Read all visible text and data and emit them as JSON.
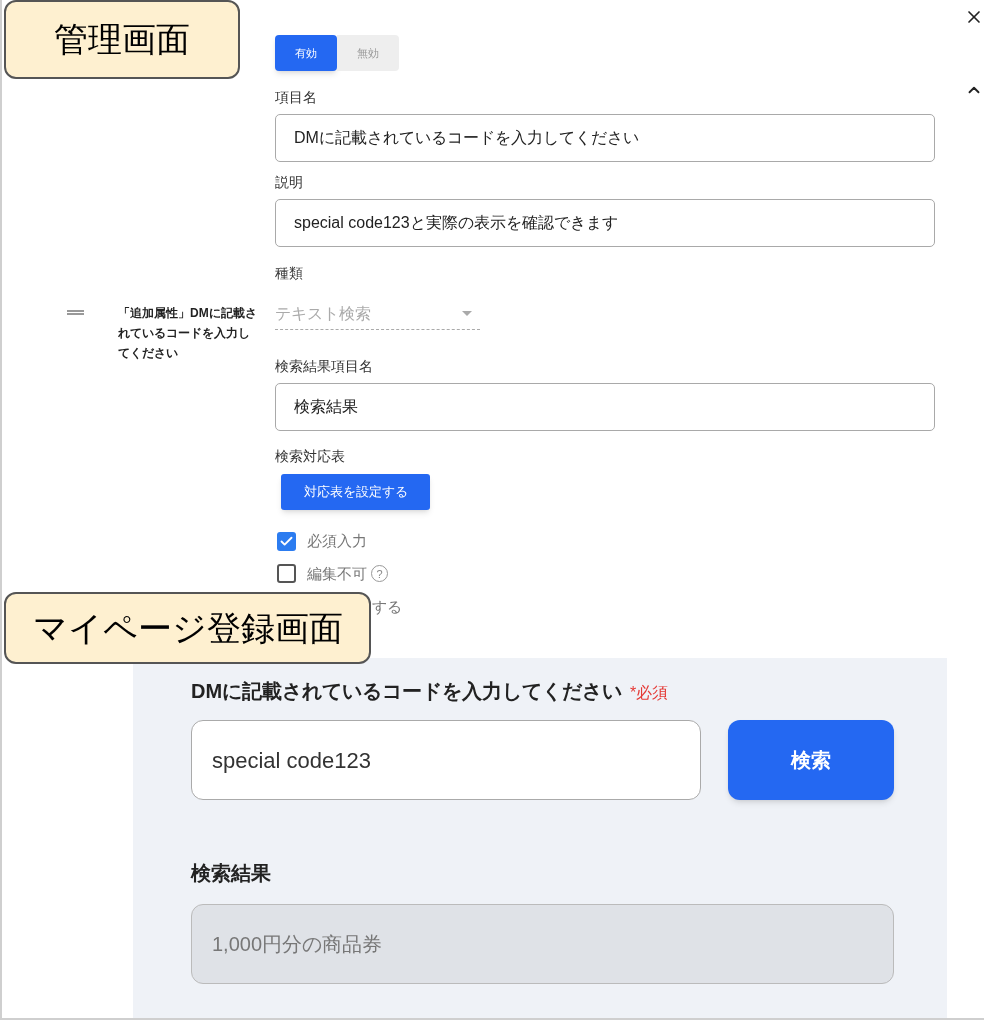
{
  "callouts": [
    {
      "text": "管理画面"
    },
    {
      "text": "マイページ登録画面"
    }
  ],
  "toggle": [
    {
      "label": "有効",
      "selected": true
    },
    {
      "label": "無効",
      "selected": false
    }
  ],
  "item": {
    "label": "「追加属性」DMに記載されているコードを入力してください"
  },
  "fields": [
    {
      "label": "項目名",
      "value": "DMに記載されているコードを入力してください"
    },
    {
      "label": "説明",
      "value": "special code123と実際の表示を確認できます"
    }
  ],
  "type_select": {
    "label": "種類",
    "value": "テキスト検索"
  },
  "result_field": {
    "label": "検索結果項目名",
    "value": "検索結果"
  },
  "mapping": {
    "label": "検索対応表",
    "button": "対応表を設定する"
  },
  "checkboxes": [
    {
      "label": "必須入力",
      "checked": true
    },
    {
      "label": "編集不可",
      "checked": false,
      "help_icon": "?"
    }
  ],
  "partial_option": "する",
  "preview": {
    "title": "DMに記載されているコードを入力してください",
    "required": "*必須",
    "input_value": "special code123",
    "search_button": "検索",
    "result_label": "検索結果",
    "result_value": "1,000円分の商品券"
  }
}
